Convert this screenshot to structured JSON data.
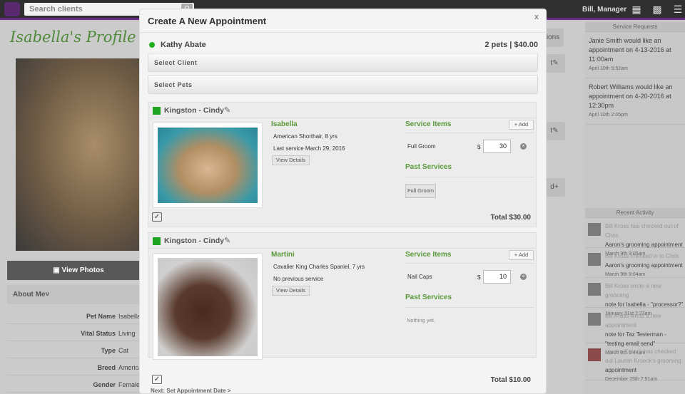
{
  "topbar": {
    "search_placeholder": "Search clients",
    "search_icon": "magnifier-icon",
    "user_label": "Bill, Manager",
    "icons": [
      "calendar-icon",
      "cash-register-icon",
      "menu-icon"
    ]
  },
  "profile": {
    "title": "Isabella's Profile",
    "view_photos": "View Photos",
    "about_me": "About Me",
    "fields": [
      {
        "label": "Pet Name",
        "value": "Isabella"
      },
      {
        "label": "Vital Status",
        "value": "Living"
      },
      {
        "label": "Type",
        "value": "Cat"
      },
      {
        "label": "Breed",
        "value": "American"
      },
      {
        "label": "Gender",
        "value": "Female"
      }
    ]
  },
  "side_buttons": {
    "options_label": "ions",
    "btn_b": "t",
    "btn_c": "t",
    "btn_d": "d"
  },
  "service_requests": {
    "header": "Service Requests",
    "items": [
      {
        "text": "Janie Smith would like an appointment on 4-13-2016 at 11:00am",
        "date": "April 10th 5:52am"
      },
      {
        "text": "Robert Williams would like an appointment on 4-20-2016 at 12:30pm",
        "date": "April 10th 2:05pm"
      }
    ]
  },
  "recent_activity": {
    "header": "Recent Activity",
    "items": [
      {
        "grey": "Bill Kross has checked out of Chris",
        "text": "Aaron's grooming appointment",
        "date": "March 9th 9:05am"
      },
      {
        "grey": "Bill Kross checked in to Chris",
        "text": "Aaron's grooming appointment",
        "date": "March 9th 9:04am"
      },
      {
        "grey": "Bill Kross wrote a new grooming",
        "text": "note for Isabella - \"processor?\"",
        "date": "January 31st 2:23am"
      },
      {
        "grey": "Bill Kross wrote a new appointment",
        "text": "note for Taz Testerman - \"testing email send\"",
        "date": "March 9th 9:44am"
      },
      {
        "grey": "Lauren Kroeck has checked out Lauren Kroeck's grooming",
        "text": "appointment",
        "date": "December 25th 7:51am"
      }
    ]
  },
  "modal": {
    "title": "Create A New Appointment",
    "close": "x",
    "client_name": "Kathy Abate",
    "client_summary": "2 pets | $40.00",
    "select_client": "Select Client",
    "select_pets": "Select Pets",
    "next_link": "Next: Set Appointment Date >",
    "pets": [
      {
        "groomer": "Kingston - Cindy",
        "name": "Isabella",
        "breed": "American Shorthair, 8 yrs",
        "last_service": "Last service March 29, 2016",
        "view_details": "View Details",
        "service_items_label": "Service Items",
        "add_label": "Add",
        "service_item": "Full Groom",
        "currency": "$",
        "price": "30",
        "past_services_label": "Past Services",
        "past_service": "Full Groom",
        "total": "Total $30.00"
      },
      {
        "groomer": "Kingston - Cindy",
        "name": "Martini",
        "breed": "Cavalier King Charles Spaniel, 7 yrs",
        "last_service": "No previous service",
        "view_details": "View Details",
        "service_items_label": "Service Items",
        "add_label": "Add",
        "service_item": "Nail Caps",
        "currency": "$",
        "price": "10",
        "past_services_label": "Past Services",
        "past_service_empty": "Nothing yet.",
        "total": "Total $10.00"
      }
    ]
  },
  "colors": {
    "accent_purple": "#6a2c82",
    "green_label": "#5a9a3a",
    "status_green": "#22b11f"
  }
}
